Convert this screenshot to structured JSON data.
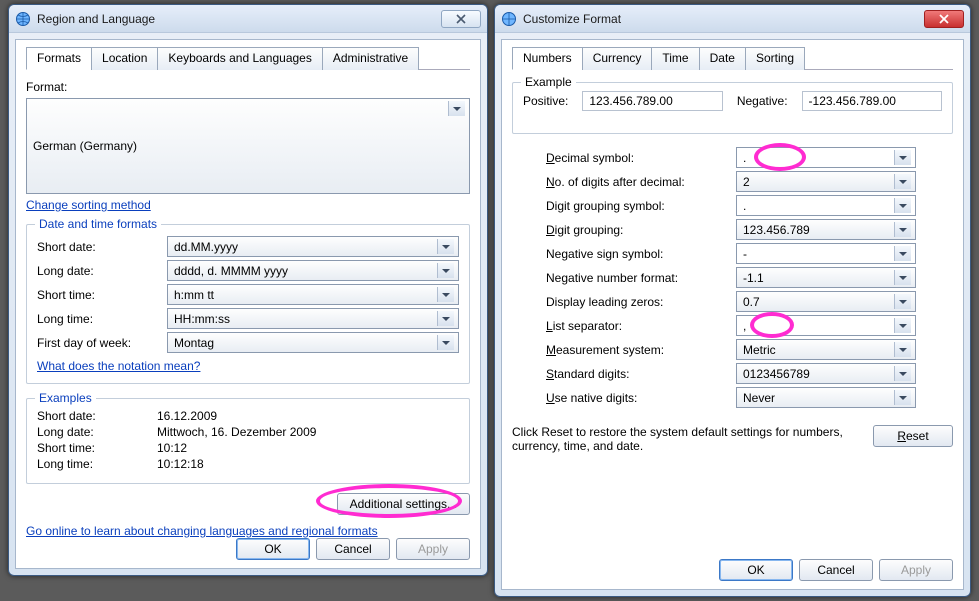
{
  "left": {
    "title": "Region and Language",
    "tabs": [
      "Formats",
      "Location",
      "Keyboards and Languages",
      "Administrative"
    ],
    "format_label": "Format:",
    "format_value": "German (Germany)",
    "sorting_link": "Change sorting method",
    "dtf_group": "Date and time formats",
    "rows": {
      "short_date_l": "Short date:",
      "short_date_v": "dd.MM.yyyy",
      "long_date_l": "Long date:",
      "long_date_v": "dddd, d. MMMM yyyy",
      "short_time_l": "Short time:",
      "short_time_v": "h:mm tt",
      "long_time_l": "Long time:",
      "long_time_v": "HH:mm:ss",
      "first_day_l": "First day of week:",
      "first_day_v": "Montag"
    },
    "notation_link": "What does the notation mean?",
    "examples_group": "Examples",
    "ex": {
      "short_date_l": "Short date:",
      "short_date_v": "16.12.2009",
      "long_date_l": "Long date:",
      "long_date_v": "Mittwoch, 16. Dezember 2009",
      "short_time_l": "Short time:",
      "short_time_v": "10:12",
      "long_time_l": "Long time:",
      "long_time_v": "10:12:18"
    },
    "additional_btn": "Additional settings...",
    "online_link": "Go online to learn about changing languages and regional formats",
    "ok": "OK",
    "cancel": "Cancel",
    "apply": "Apply"
  },
  "right": {
    "title": "Customize Format",
    "tabs": [
      "Numbers",
      "Currency",
      "Time",
      "Date",
      "Sorting"
    ],
    "example_group": "Example",
    "positive_l": "Positive:",
    "positive_v": "123.456.789.00",
    "negative_l": "Negative:",
    "negative_v": "-123.456.789.00",
    "rows": {
      "decimal_l": "Decimal symbol:",
      "decimal_v": ".",
      "digits_after_l_pre": "N",
      "digits_after_l_post": "o. of digits after decimal:",
      "digits_after_v": "2",
      "grouping_sym_l": "Digit grouping symbol:",
      "grouping_sym_v": ".",
      "grouping_l_pre": "D",
      "grouping_l_post": "igit grouping:",
      "grouping_v": "123.456.789",
      "neg_sign_l": "Negative sign symbol:",
      "neg_sign_v": "-",
      "neg_fmt_l": "Negative number format:",
      "neg_fmt_v": "-1.1",
      "lead_zero_l": "Display leading zeros:",
      "lead_zero_v": "0.7",
      "list_sep_l_pre": "L",
      "list_sep_l_post": "ist separator:",
      "list_sep_v": ",",
      "measure_l_pre": "M",
      "measure_l_post": "easurement system:",
      "measure_v": "Metric",
      "std_digits_l_pre": "S",
      "std_digits_l_post": "tandard digits:",
      "std_digits_v": "0123456789",
      "native_l_pre": "U",
      "native_l_post": "se native digits:",
      "native_v": "Never"
    },
    "reset_text": "Click Reset to restore the system default settings for numbers, currency, time, and date.",
    "reset_btn_pre": "R",
    "reset_btn_post": "eset",
    "ok": "OK",
    "cancel": "Cancel",
    "apply": "Apply"
  }
}
